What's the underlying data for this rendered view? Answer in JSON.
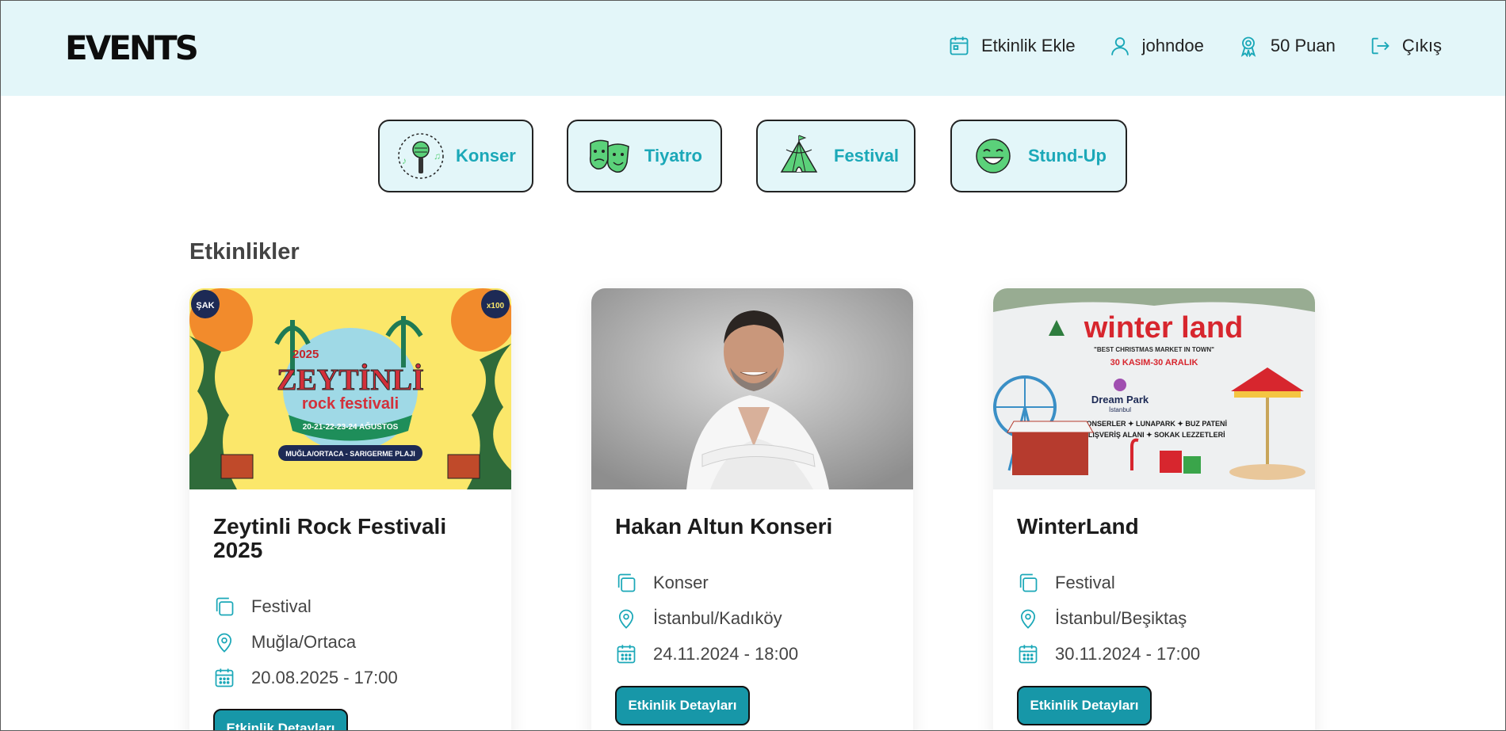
{
  "header": {
    "logo": "EVENTS",
    "nav": {
      "add_event": "Etkinlik Ekle",
      "username": "johndoe",
      "points": "50 Puan",
      "logout": "Çıkış"
    }
  },
  "categories": [
    {
      "label": "Konser",
      "icon": "microphone-icon"
    },
    {
      "label": "Tiyatro",
      "icon": "theater-masks-icon"
    },
    {
      "label": "Festival",
      "icon": "circus-tent-icon"
    },
    {
      "label": "Stund-Up",
      "icon": "laughing-face-icon"
    }
  ],
  "events_section": {
    "title": "Etkinlikler",
    "cards": [
      {
        "title": "Zeytinli Rock Festivali 2025",
        "category": "Festival",
        "location": "Muğla/Ortaca",
        "datetime": "20.08.2025 - 17:00",
        "button": "Etkinlik Detayları",
        "poster": {
          "year": "2025",
          "name_line1": "ZEYTİNLİ",
          "name_line2": "rock festivali",
          "dates": "20-21-22-23-24 AĞUSTOS",
          "place": "MUĞLA/ORTACA - SARIGERME PLAJI",
          "badge_left": "ŞAK",
          "badge_right": "x100"
        }
      },
      {
        "title": "Hakan Altun Konseri",
        "category": "Konser",
        "location": "İstanbul/Kadıköy",
        "datetime": "24.11.2024 - 18:00",
        "button": "Etkinlik Detayları"
      },
      {
        "title": "WinterLand",
        "category": "Festival",
        "location": "İstanbul/Beşiktaş",
        "datetime": "30.11.2024 - 17:00",
        "button": "Etkinlik Detayları",
        "poster": {
          "name": "winter land",
          "tagline": "\"BEST CHRISTMAS MARKET IN TOWN\"",
          "dates": "30 KASIM-30 ARALIK",
          "venue": "Dream Park",
          "venue_sub": "İstanbul",
          "features_line1": "KONSERLER ✦ LUNAPARK ✦ BUZ PATENİ",
          "features_line2": "ALIŞVERİŞ ALANI ✦ SOKAK LEZZETLERİ"
        }
      }
    ]
  },
  "colors": {
    "header_bg": "#e3f6f9",
    "accent": "#1ba8b8",
    "button_bg": "#1797a8"
  }
}
